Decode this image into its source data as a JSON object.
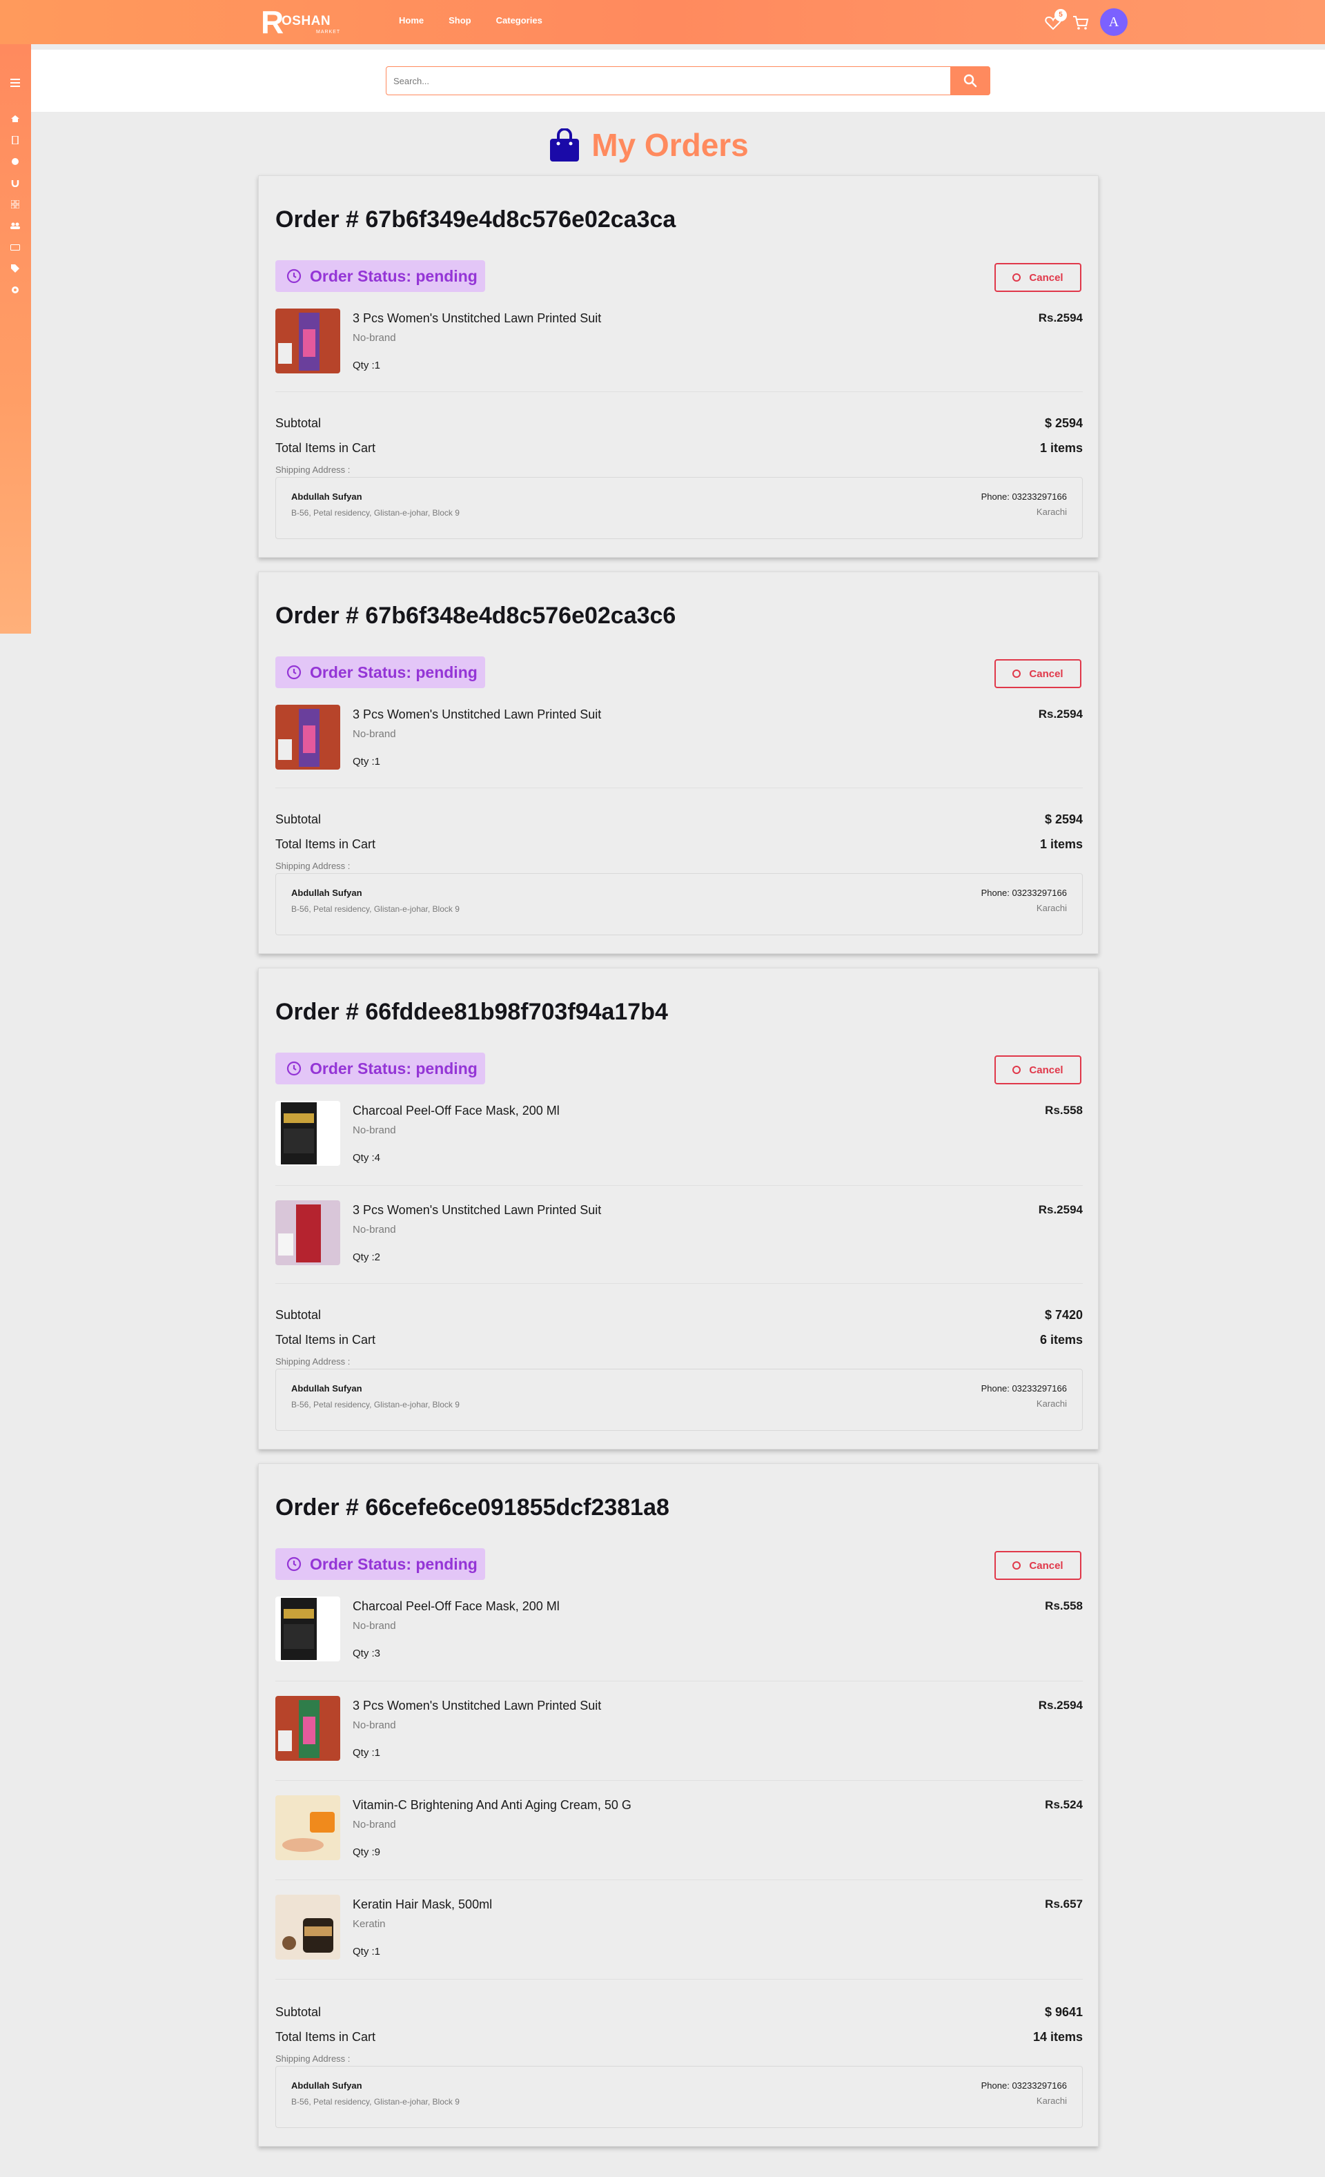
{
  "nav": {
    "logo_letter": "R",
    "logo_text": "OSHAN",
    "logo_sub": "MARKET",
    "links": [
      "Home",
      "Shop",
      "Categories"
    ],
    "wishlist_count": "5",
    "avatar_letter": "A"
  },
  "search": {
    "placeholder": "Search..."
  },
  "page": {
    "title": "My Orders"
  },
  "colors": {
    "accent": "#ff8a5e",
    "status_bg": "#e3c6f7",
    "status_text": "#9435d6",
    "cancel": "#e0384a",
    "bag_icon": "#1a0aa8"
  },
  "orders": [
    {
      "id_label": "Order # 67b6f349e4d8c576e02ca3ca",
      "status": "Order Status: pending",
      "cancel_label": "Cancel",
      "items": [
        {
          "name": "3 Pcs Women's Unstitched Lawn Printed Suit",
          "brand": "No-brand",
          "qty": "Qty :1",
          "price": "Rs.2594",
          "thumb": "suit-purple"
        }
      ],
      "subtotal_label": "Subtotal",
      "subtotal": "$ 2594",
      "items_label": "Total Items in Cart",
      "items_count": "1 items",
      "ship_label": "Shipping Address :",
      "address": {
        "name": "Abdullah Sufyan",
        "line": "B-56, Petal residency, Glistan-e-johar, Block 9",
        "phone": "Phone: 03233297166",
        "city": "Karachi"
      }
    },
    {
      "id_label": "Order # 67b6f348e4d8c576e02ca3c6",
      "status": "Order Status: pending",
      "cancel_label": "Cancel",
      "items": [
        {
          "name": "3 Pcs Women's Unstitched Lawn Printed Suit",
          "brand": "No-brand",
          "qty": "Qty :1",
          "price": "Rs.2594",
          "thumb": "suit-purple"
        }
      ],
      "subtotal_label": "Subtotal",
      "subtotal": "$ 2594",
      "items_label": "Total Items in Cart",
      "items_count": "1 items",
      "ship_label": "Shipping Address :",
      "address": {
        "name": "Abdullah Sufyan",
        "line": "B-56, Petal residency, Glistan-e-johar, Block 9",
        "phone": "Phone: 03233297166",
        "city": "Karachi"
      }
    },
    {
      "id_label": "Order # 66fddee81b98f703f94a17b4",
      "status": "Order Status: pending",
      "cancel_label": "Cancel",
      "items": [
        {
          "name": "Charcoal Peel-Off Face Mask, 200 Ml",
          "brand": "No-brand",
          "qty": "Qty :4",
          "price": "Rs.558",
          "thumb": "mask"
        },
        {
          "name": "3 Pcs Women's Unstitched Lawn Printed Suit",
          "brand": "No-brand",
          "qty": "Qty :2",
          "price": "Rs.2594",
          "thumb": "suit-red"
        }
      ],
      "subtotal_label": "Subtotal",
      "subtotal": "$ 7420",
      "items_label": "Total Items in Cart",
      "items_count": "6 items",
      "ship_label": "Shipping Address :",
      "address": {
        "name": "Abdullah Sufyan",
        "line": "B-56, Petal residency, Glistan-e-johar, Block 9",
        "phone": "Phone: 03233297166",
        "city": "Karachi"
      }
    },
    {
      "id_label": "Order # 66cefe6ce091855dcf2381a8",
      "status": "Order Status: pending",
      "cancel_label": "Cancel",
      "items": [
        {
          "name": "Charcoal Peel-Off Face Mask, 200 Ml",
          "brand": "No-brand",
          "qty": "Qty :3",
          "price": "Rs.558",
          "thumb": "mask"
        },
        {
          "name": "3 Pcs Women's Unstitched Lawn Printed Suit",
          "brand": "No-brand",
          "qty": "Qty :1",
          "price": "Rs.2594",
          "thumb": "suit-green"
        },
        {
          "name": "Vitamin-C Brightening And Anti Aging Cream, 50 G",
          "brand": "No-brand",
          "qty": "Qty :9",
          "price": "Rs.524",
          "thumb": "cream"
        },
        {
          "name": "Keratin Hair Mask, 500ml",
          "brand": "Keratin",
          "qty": "Qty :1",
          "price": "Rs.657",
          "thumb": "hair"
        }
      ],
      "subtotal_label": "Subtotal",
      "subtotal": "$ 9641",
      "items_label": "Total Items in Cart",
      "items_count": "14 items",
      "ship_label": "Shipping Address :",
      "address": {
        "name": "Abdullah Sufyan",
        "line": "B-56, Petal residency, Glistan-e-johar, Block 9",
        "phone": "Phone: 03233297166",
        "city": "Karachi"
      }
    }
  ]
}
